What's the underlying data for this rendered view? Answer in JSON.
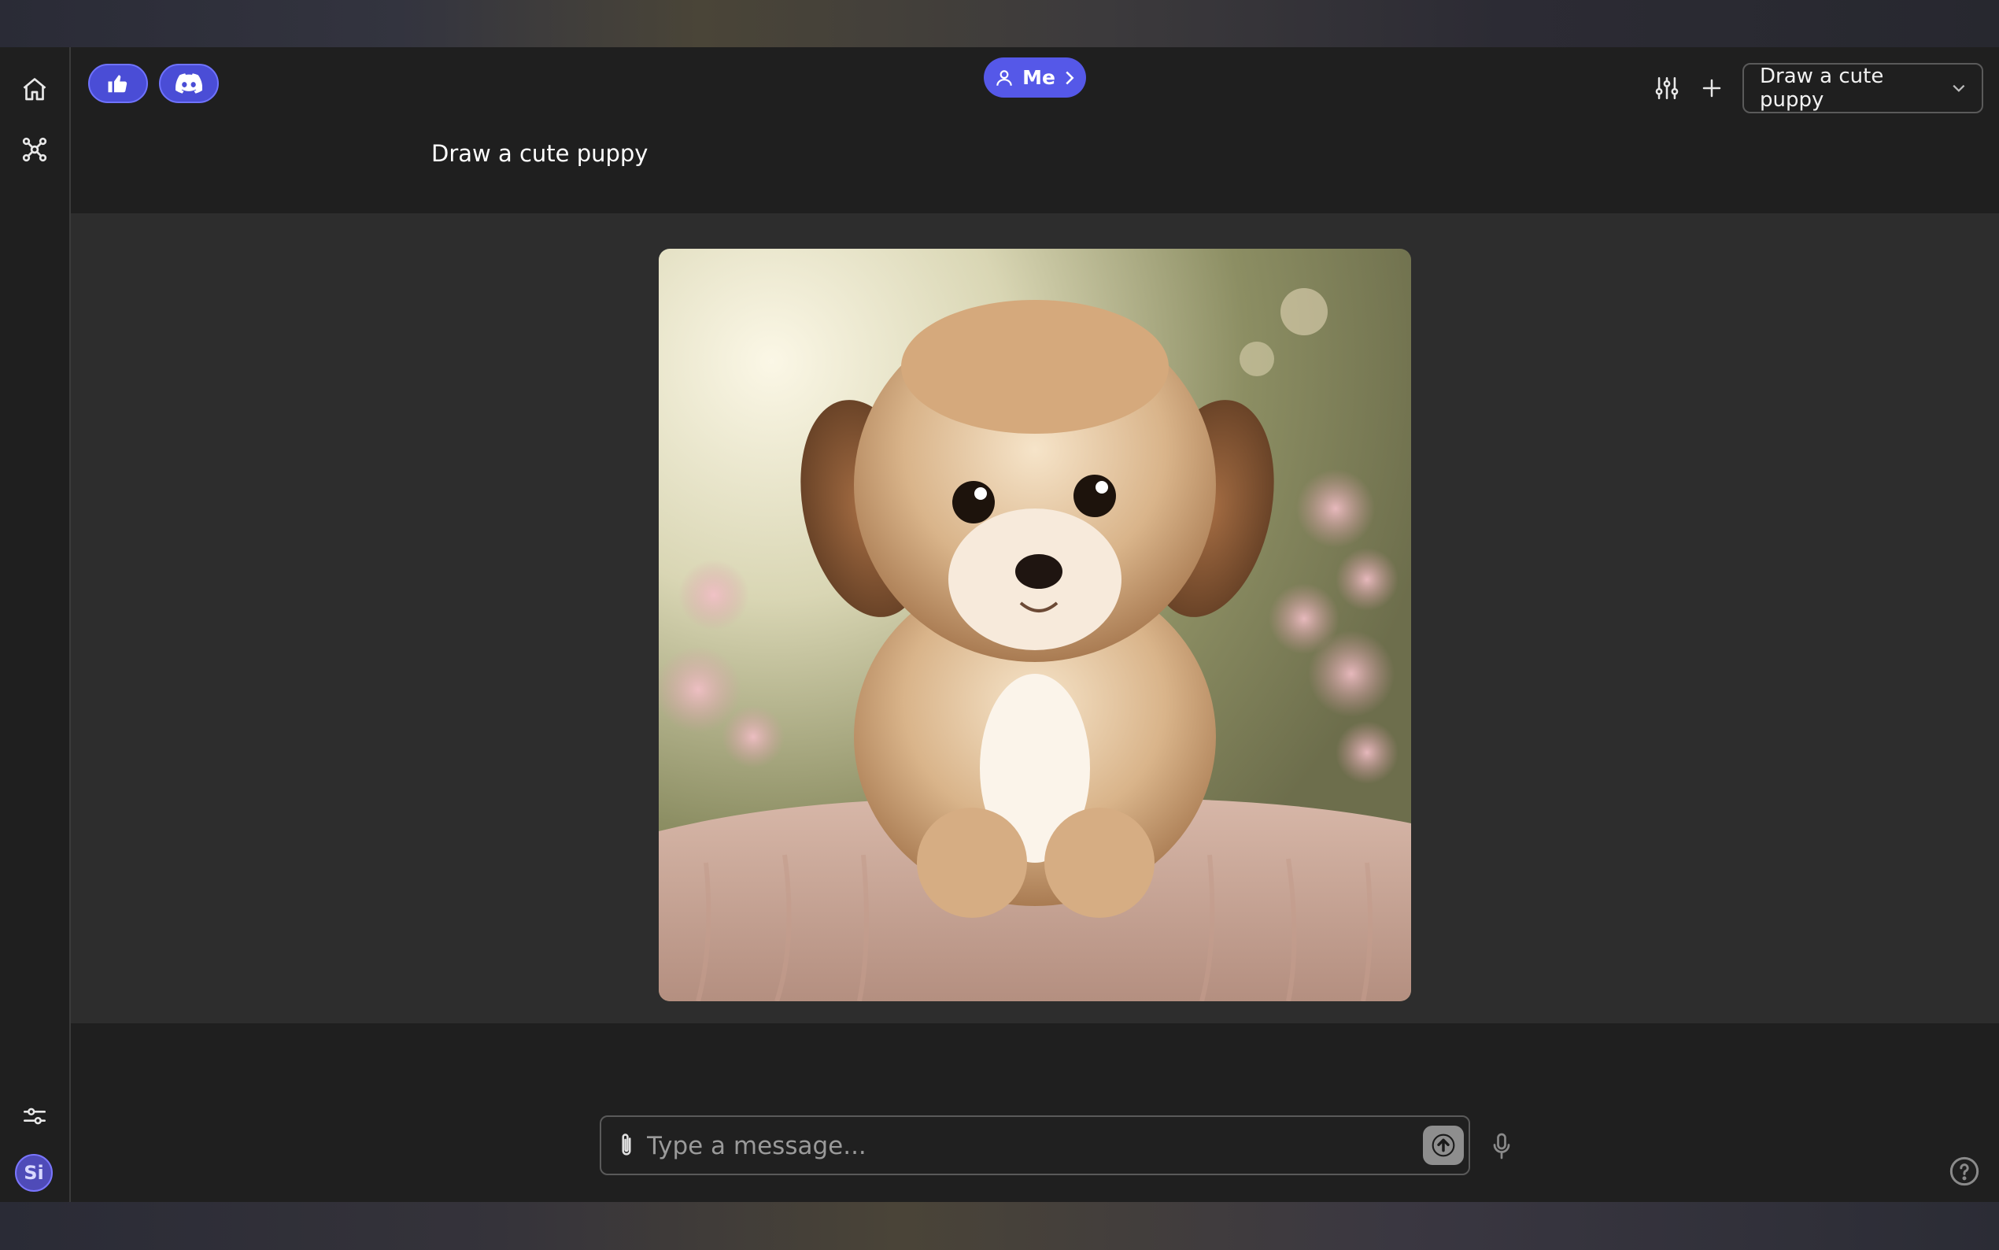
{
  "header": {
    "me_label": "Me",
    "prompt_text": "Draw a cute puppy",
    "conversation_dropdown": {
      "selected": "Draw a cute puppy"
    }
  },
  "composer": {
    "placeholder": "Type a message..."
  },
  "sidebar": {
    "avatar_initials": "Si",
    "icons": [
      "home-icon",
      "workflow-icon",
      "settings-sliders-icon"
    ]
  },
  "colors": {
    "accent": "#5558e8",
    "app_background": "#1f1f1f",
    "stage_background": "#2d2d2d"
  }
}
